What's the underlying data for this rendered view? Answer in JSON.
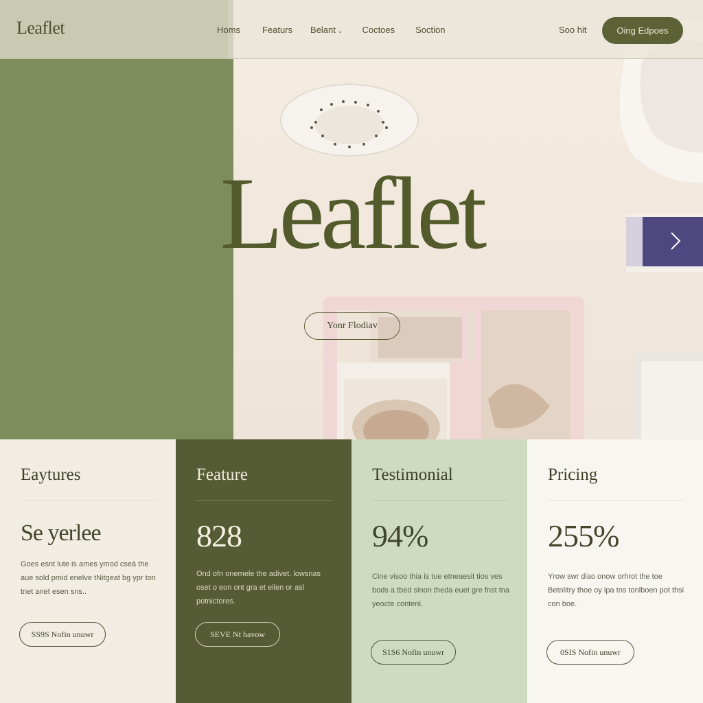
{
  "brand": {
    "logo_text": "Leaflet"
  },
  "nav": {
    "links": [
      "Homs",
      "Featurs",
      "Belant",
      "Coctoes",
      "Soction"
    ],
    "signin": "Soo hit",
    "cta": "Oing Edpoes"
  },
  "hero": {
    "title": "Leaflet",
    "button": "Yonr Flodiav"
  },
  "cards": [
    {
      "title": "Eaytures",
      "stat": "Se yerlee",
      "body": "Goes esnt lute is ames ymod cseá the aue sold pmid enelve tNitgeat bg ypr ton tnet anet esen sns..",
      "button": "SS9S Nofin unuwr"
    },
    {
      "title": "Feature",
      "stat": "828",
      "body": "Ond ofn onemele the adivet. lowsnas oset o eon ont gra et eilen or asl potnictores.",
      "button": "SEVE Nt havow"
    },
    {
      "title": "Testimonial",
      "stat": "94%",
      "body": "Cine visoo thia is tue etneaesit tios ves bods a tbed sinon theda euet gre fnst tna yeocte contenl.",
      "button": "S1S6 Nofin unuwr"
    },
    {
      "title": "Pricing",
      "stat": "255%",
      "body": "Yrow swr diao onow orhrot the toe Betnlitry thoe oy ipa tns tonlboen pot thsi con boe.",
      "button": "0SIS Nofin unuwr"
    }
  ],
  "colors": {
    "olive_dark": "#555b34",
    "olive_mid": "#7d8d5b",
    "sage": "#cfdbc0",
    "cream": "#f1ede2",
    "accent_button": "#5d6136"
  },
  "icons": {
    "hero_next": "chevron-right-icon",
    "nav_caret": "chevron-down-icon"
  }
}
